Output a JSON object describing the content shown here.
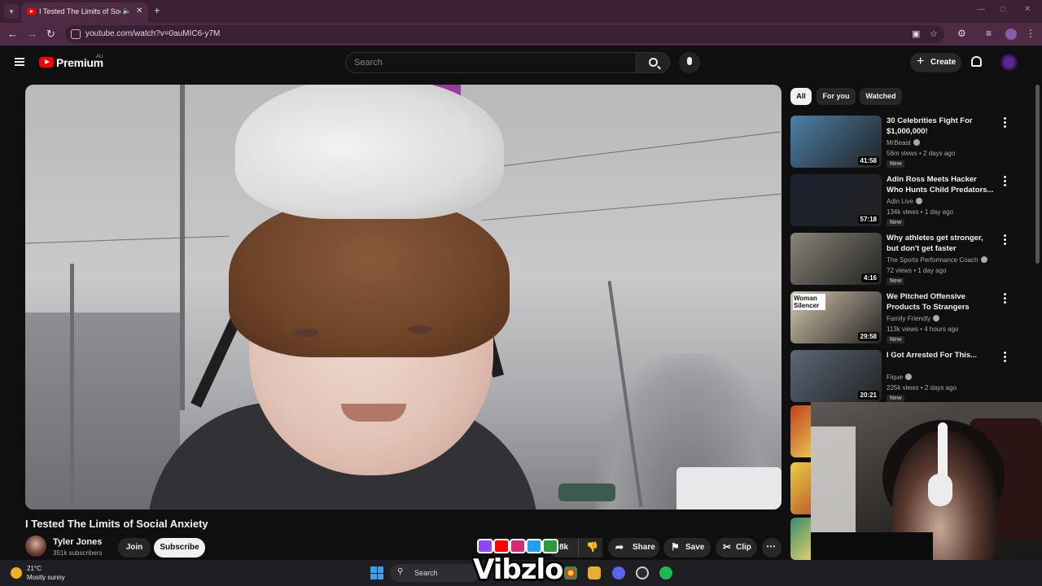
{
  "browser": {
    "tab_title": "I Tested The Limits of Social Anxiety",
    "url": "youtube.com/watch?v=0auMIC6-y7M"
  },
  "header": {
    "logo_text": "Premium",
    "region": "AU",
    "search_placeholder": "Search",
    "create_label": "Create"
  },
  "video": {
    "title": "I Tested The Limits of Social Anxiety",
    "channel": "Tyler Jones",
    "subscribers": "351k subscribers",
    "join_label": "Join",
    "subscribe_label": "Subscribe",
    "like_count": "8k",
    "share_label": "Share",
    "save_label": "Save",
    "clip_label": "Clip"
  },
  "sidebar": {
    "chips": [
      "All",
      "For you",
      "Watched"
    ],
    "recommendations": [
      {
        "title": "30 Celebrities Fight For $1,000,000!",
        "channel": "MrBeast",
        "meta": "56m views • 2 days ago",
        "duration": "41:58",
        "badge": "New",
        "thumb_color": "#4a7fa8"
      },
      {
        "title": "Adin Ross Meets Hacker Who Hunts Child Predators...",
        "channel": "Adin Live",
        "meta": "134k views • 1 day ago",
        "duration": "57:18",
        "badge": "New",
        "thumb_color": "#1c2230"
      },
      {
        "title": "Why athletes get stronger, but don't get faster",
        "channel": "The Sports Performance Coach",
        "meta": "72 views • 1 day ago",
        "duration": "4:16",
        "badge": "New",
        "thumb_color": "#8a8478"
      },
      {
        "title": "We Pitched Offensive Products To Strangers",
        "channel": "Family Friendly",
        "meta": "113k views • 4 hours ago",
        "duration": "29:58",
        "badge": "New",
        "thumb_color": "#d8c8b0",
        "thumb_text": "Woman Silencer"
      },
      {
        "title": "I Got Arrested For This...",
        "channel": "Fique",
        "meta": "225k views • 2 days ago",
        "duration": "20:21",
        "badge": "New",
        "thumb_color": "#5a6878"
      }
    ]
  },
  "taskbar": {
    "temperature": "21°C",
    "weather": "Mostly sunny",
    "search_label": "Search"
  },
  "overlay": {
    "brand": "Vibzlo"
  }
}
